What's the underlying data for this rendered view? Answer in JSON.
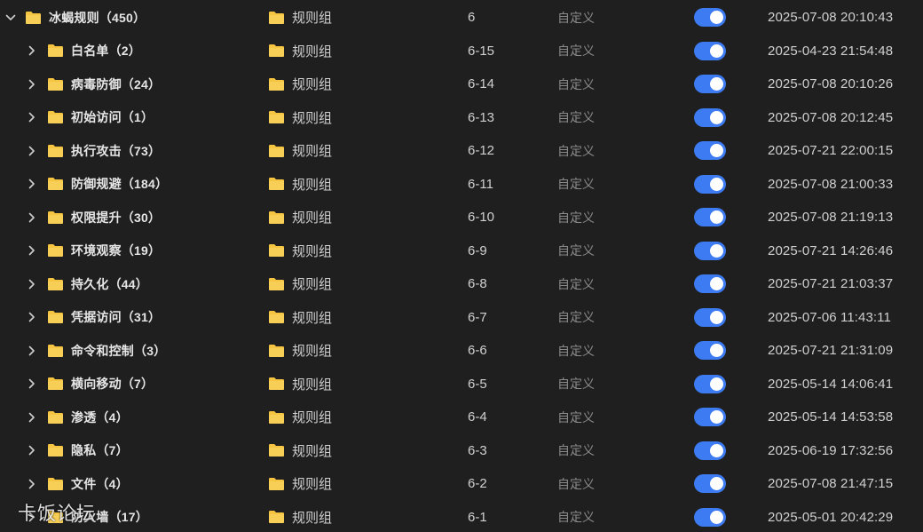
{
  "tree": {
    "root": {
      "name": "冰蝎规则（450）",
      "type": "规则组",
      "code": "6",
      "source": "自定义",
      "enabled": true,
      "updated": "2025-07-08 20:10:43",
      "expanded": true
    },
    "children": [
      {
        "name": "白名单（2）",
        "type": "规则组",
        "code": "6-15",
        "source": "自定义",
        "enabled": true,
        "updated": "2025-04-23 21:54:48"
      },
      {
        "name": "病毒防御（24）",
        "type": "规则组",
        "code": "6-14",
        "source": "自定义",
        "enabled": true,
        "updated": "2025-07-08 20:10:26"
      },
      {
        "name": "初始访问（1）",
        "type": "规则组",
        "code": "6-13",
        "source": "自定义",
        "enabled": true,
        "updated": "2025-07-08 20:12:45"
      },
      {
        "name": "执行攻击（73）",
        "type": "规则组",
        "code": "6-12",
        "source": "自定义",
        "enabled": true,
        "updated": "2025-07-21 22:00:15"
      },
      {
        "name": "防御规避（184）",
        "type": "规则组",
        "code": "6-11",
        "source": "自定义",
        "enabled": true,
        "updated": "2025-07-08 21:00:33"
      },
      {
        "name": "权限提升（30）",
        "type": "规则组",
        "code": "6-10",
        "source": "自定义",
        "enabled": true,
        "updated": "2025-07-08 21:19:13"
      },
      {
        "name": "环境观察（19）",
        "type": "规则组",
        "code": "6-9",
        "source": "自定义",
        "enabled": true,
        "updated": "2025-07-21 14:26:46"
      },
      {
        "name": "持久化（44）",
        "type": "规则组",
        "code": "6-8",
        "source": "自定义",
        "enabled": true,
        "updated": "2025-07-21 21:03:37"
      },
      {
        "name": "凭据访问（31）",
        "type": "规则组",
        "code": "6-7",
        "source": "自定义",
        "enabled": true,
        "updated": "2025-07-06 11:43:11"
      },
      {
        "name": "命令和控制（3）",
        "type": "规则组",
        "code": "6-6",
        "source": "自定义",
        "enabled": true,
        "updated": "2025-07-21 21:31:09"
      },
      {
        "name": "横向移动（7）",
        "type": "规则组",
        "code": "6-5",
        "source": "自定义",
        "enabled": true,
        "updated": "2025-05-14 14:06:41"
      },
      {
        "name": "渗透（4）",
        "type": "规则组",
        "code": "6-4",
        "source": "自定义",
        "enabled": true,
        "updated": "2025-05-14 14:53:58"
      },
      {
        "name": "隐私（7）",
        "type": "规则组",
        "code": "6-3",
        "source": "自定义",
        "enabled": true,
        "updated": "2025-06-19 17:32:56"
      },
      {
        "name": "文件（4）",
        "type": "规则组",
        "code": "6-2",
        "source": "自定义",
        "enabled": true,
        "updated": "2025-07-08 21:47:15"
      },
      {
        "name": "防火墙（17）",
        "type": "规则组",
        "code": "6-1",
        "source": "自定义",
        "enabled": true,
        "updated": "2025-05-01 20:42:29"
      }
    ]
  },
  "watermark": "卡饭论坛",
  "colors": {
    "background": "#1f1f1f",
    "folder": "#f5c542",
    "toggle_on": "#3d7bf2",
    "text": "#d0d0d0",
    "muted": "#8a8a8a"
  },
  "icons": {
    "expanded_arrow": "chevron-down-icon",
    "collapsed_arrow": "chevron-right-icon",
    "folder": "folder-icon"
  }
}
